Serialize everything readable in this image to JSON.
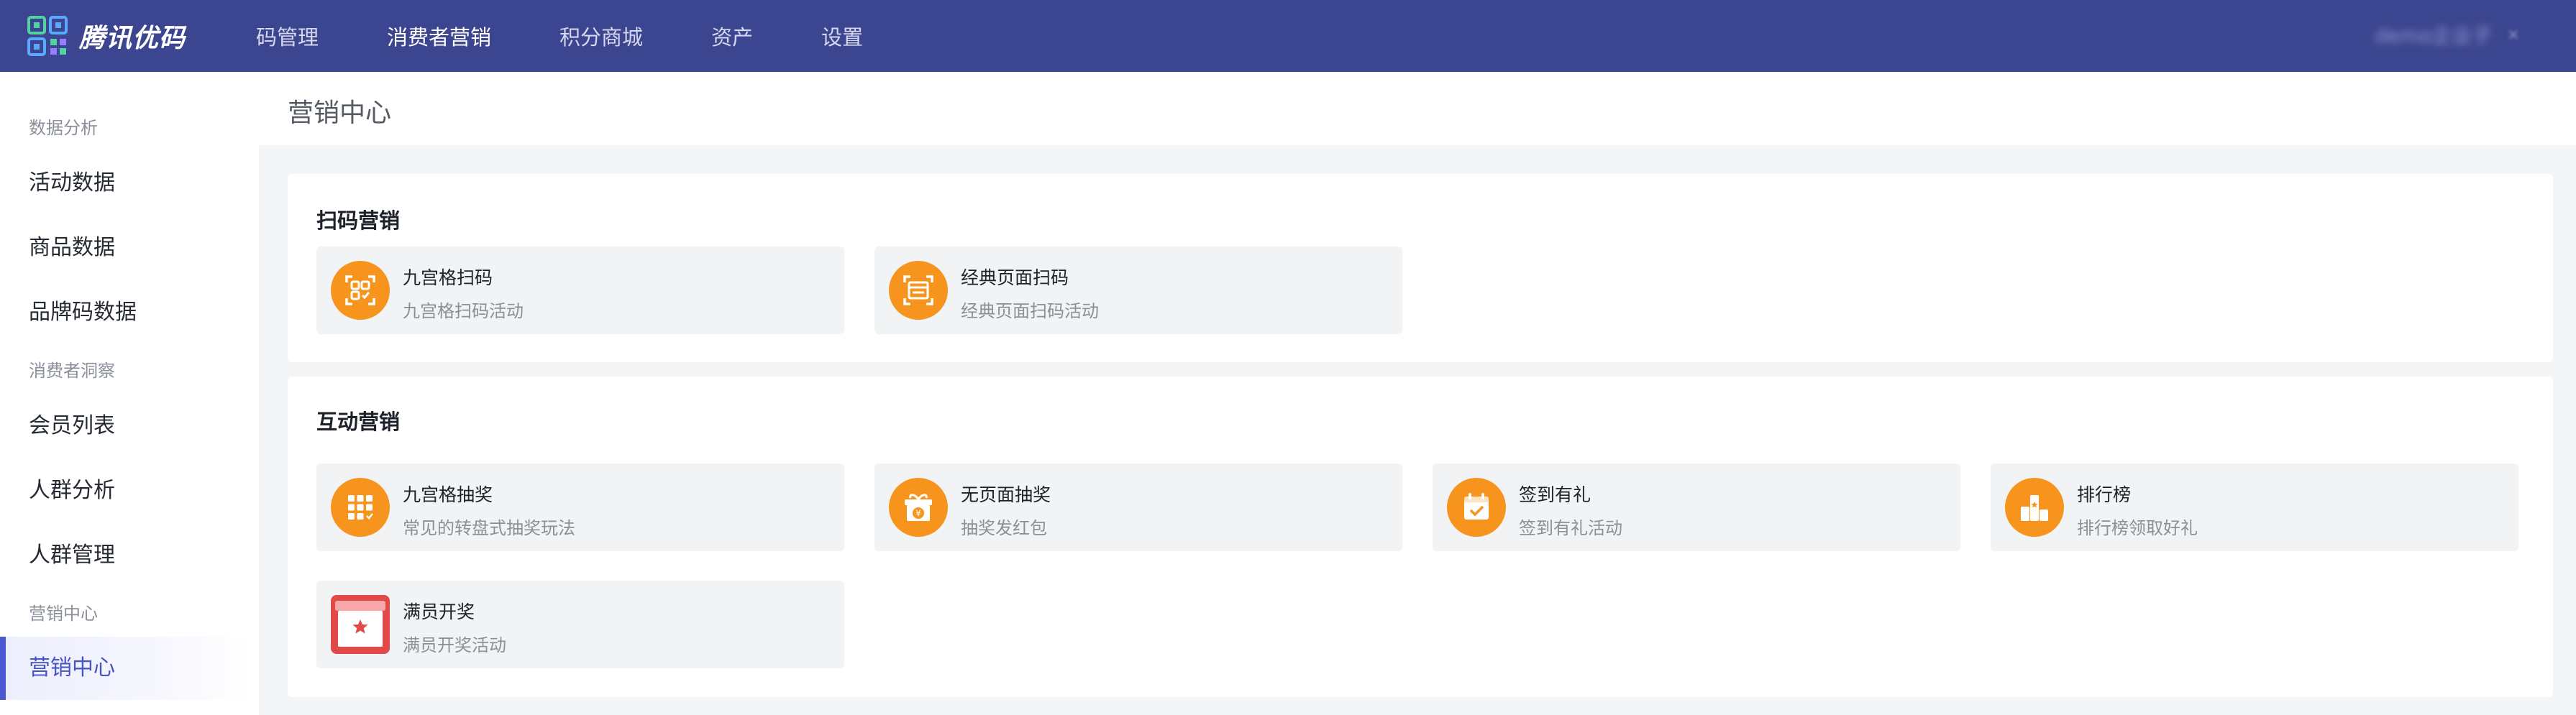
{
  "brand": {
    "name": "腾讯优码"
  },
  "topnav": {
    "items": [
      {
        "label": "码管理"
      },
      {
        "label": "消费者营销"
      },
      {
        "label": "积分商城"
      },
      {
        "label": "资产"
      },
      {
        "label": "设置"
      }
    ],
    "active_index": 1,
    "user": {
      "name": "demo企业子",
      "caret": "×"
    }
  },
  "sidebar": {
    "groups": [
      {
        "label": "数据分析",
        "items": [
          "活动数据",
          "商品数据",
          "品牌码数据"
        ]
      },
      {
        "label": "消费者洞察",
        "items": [
          "会员列表",
          "人群分析",
          "人群管理"
        ]
      },
      {
        "label": "营销中心",
        "items": [
          "营销中心"
        ]
      }
    ],
    "active_item": "营销中心"
  },
  "page": {
    "title": "营销中心"
  },
  "sections": [
    {
      "title": "扫码营销",
      "tiles": [
        {
          "name": "九宫格扫码",
          "desc": "九宫格扫码活动",
          "icon": "grid-scan-icon"
        },
        {
          "name": "经典页面扫码",
          "desc": "经典页面扫码活动",
          "icon": "page-scan-icon"
        }
      ]
    },
    {
      "title": "互动营销",
      "tiles": [
        {
          "name": "九宫格抽奖",
          "desc": "常见的转盘式抽奖玩法",
          "icon": "grid-lottery-icon"
        },
        {
          "name": "无页面抽奖",
          "desc": "抽奖发红包",
          "icon": "gift-box-icon"
        },
        {
          "name": "签到有礼",
          "desc": "签到有礼活动",
          "icon": "calendar-check-icon"
        },
        {
          "name": "排行榜",
          "desc": "排行榜领取好礼",
          "icon": "podium-icon"
        },
        {
          "name": "满员开奖",
          "desc": "满员开奖活动",
          "icon": "prize-box-icon"
        }
      ]
    }
  ],
  "colors": {
    "nav_bg": "#3c4690",
    "accent": "#4553c5",
    "icon_orange": "#f7941d",
    "icon_red": "#e24a4a"
  }
}
